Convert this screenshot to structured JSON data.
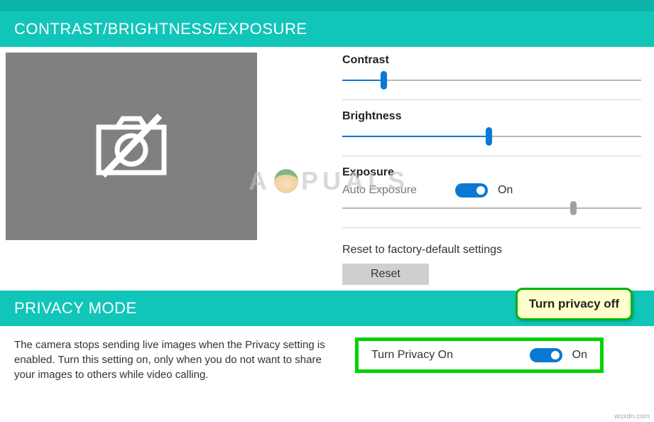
{
  "sections": {
    "contrast_header": "CONTRAST/BRIGHTNESS/EXPOSURE",
    "privacy_header": "PRIVACY MODE"
  },
  "controls": {
    "contrast": {
      "label": "Contrast",
      "value": 13,
      "min": 0,
      "max": 100
    },
    "brightness": {
      "label": "Brightness",
      "value": 49,
      "min": 0,
      "max": 100
    },
    "exposure": {
      "label": "Exposure",
      "auto_label": "Auto Exposure",
      "auto_on": true,
      "auto_state": "On",
      "value": 78,
      "min": 0,
      "max": 100
    },
    "reset": {
      "label": "Reset to factory-default settings",
      "button": "Reset"
    }
  },
  "privacy": {
    "description": "The camera stops sending live images when the Privacy setting is enabled. Turn this setting on, only when you do not want to share your images to others while video calling.",
    "toggle_label": "Turn Privacy On",
    "toggle_state": "On",
    "callout": "Turn privacy off"
  },
  "watermark_logo": "A PUALS",
  "watermark_site": "wsxdn.com"
}
